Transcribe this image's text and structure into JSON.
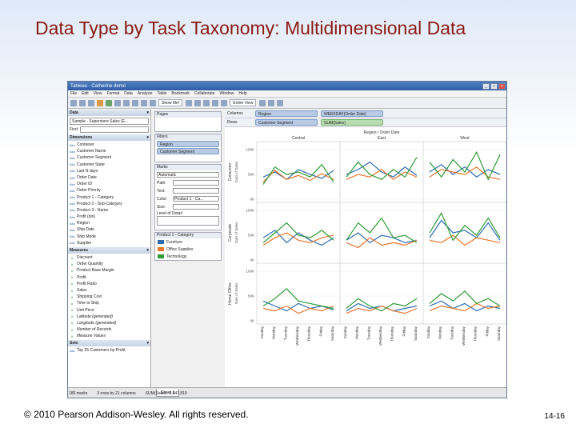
{
  "slide": {
    "title": "Data Type by Task Taxonomy: Multidimensional Data",
    "copyright": "© 2010 Pearson Addison-Wesley. All rights reserved.",
    "page_number": "14-16"
  },
  "window": {
    "title": "Tableau - Catherine demo",
    "menu": [
      "File",
      "Edit",
      "View",
      "Format",
      "Data",
      "Analysis",
      "Table",
      "Bookmark",
      "Collaborate",
      "Window",
      "Help"
    ],
    "toolbar": {
      "show_me": "Show Me!",
      "view_mode": "Entire View"
    }
  },
  "data_pane": {
    "header": "Data",
    "datasource": "Sample - Superstore Sales (E...",
    "find_label": "Find:",
    "dimensions_header": "Dimensions",
    "dimensions": [
      "Container",
      "Customer Name",
      "Customer Segment",
      "Customer State",
      "Last N days",
      "Order Date",
      "Order ID",
      "Order Priority",
      "Product 1 - Category",
      "Product 2 - Sub-Category",
      "Product 3 - Name",
      "Profit (bin)",
      "Region",
      "Ship Date",
      "Ship Mode",
      "Supplier"
    ],
    "measures_header": "Measures",
    "measures": [
      "Discount",
      "Order Quantity",
      "Product Base Margin",
      "Profit",
      "Profit Ratio",
      "Sales",
      "Shipping Cost",
      "Time to Ship",
      "Unit Price",
      "Latitude (generated)",
      "Longitude (generated)",
      "Number of Records",
      "Measure Values"
    ],
    "sets_header": "Sets",
    "sets": [
      "Top 25 Customers by Profit"
    ]
  },
  "shelves": {
    "pages": "Pages",
    "filters": "Filters",
    "filter_items": [
      "Region",
      "Customer Segment"
    ],
    "marks": "Marks",
    "mark_type": "Automatic",
    "path": "Path:",
    "text": "Text:",
    "color": "Color:",
    "color_field": "Product 1 - Ca...",
    "size": "Size:",
    "level_of_detail": "Level of Detail",
    "legend_title": "Product 1 - Category",
    "legend": [
      {
        "name": "Furniture",
        "color": "#2b6cb0"
      },
      {
        "name": "Office Supplies",
        "color": "#e8772e"
      },
      {
        "name": "Technology",
        "color": "#2e9b36"
      }
    ],
    "columns_label": "Columns",
    "columns": [
      "Region",
      "WEEKDAY(Order Date)"
    ],
    "rows_label": "Rows",
    "rows": [
      "Customer Segment",
      "SUM(Sales)"
    ]
  },
  "status": {
    "sheet_tab": "Sheet 1",
    "marks": "189 marks",
    "dims": "3 rows by 21 columns",
    "sum": "SUM(Sales): 8,947,819"
  },
  "chart_data": {
    "type": "line",
    "header_title": "Region / Order Date",
    "regions": [
      "Central",
      "East",
      "West"
    ],
    "segments": [
      "Consumer",
      "Corporate",
      "Home Office"
    ],
    "ylabel": "Sum of Sales",
    "yticks": [
      "0K",
      "50K",
      "100K"
    ],
    "ylim": [
      0,
      110000
    ],
    "categories": [
      "Sunday",
      "Monday",
      "Tuesday",
      "Wednesday",
      "Thursday",
      "Friday",
      "Saturday"
    ],
    "series_names": [
      "Furniture",
      "Office Supplies",
      "Technology"
    ],
    "colors": [
      "#2b6cb0",
      "#e8772e",
      "#2e9b36"
    ],
    "values": [
      [
        [
          [
            45000,
            55000,
            40000,
            60000,
            50000,
            42000,
            58000
          ],
          [
            35000,
            58000,
            40000,
            48000,
            38000,
            52000,
            40000
          ],
          [
            30000,
            65000,
            50000,
            55000,
            45000,
            70000,
            35000
          ]
        ],
        [
          [
            50000,
            60000,
            75000,
            55000,
            45000,
            65000,
            48000
          ],
          [
            40000,
            50000,
            45000,
            60000,
            40000,
            55000,
            45000
          ],
          [
            45000,
            75000,
            50000,
            40000,
            60000,
            45000,
            85000
          ]
        ],
        [
          [
            55000,
            70000,
            50000,
            65000,
            45000,
            60000,
            50000
          ],
          [
            45000,
            60000,
            55000,
            50000,
            65000,
            45000,
            40000
          ],
          [
            75000,
            45000,
            80000,
            55000,
            95000,
            40000,
            90000
          ]
        ]
      ],
      [
        [
          [
            45000,
            60000,
            35000,
            55000,
            40000,
            30000,
            45000
          ],
          [
            30000,
            45000,
            55000,
            40000,
            35000,
            45000,
            50000
          ],
          [
            35000,
            55000,
            75000,
            50000,
            45000,
            60000,
            40000
          ]
        ],
        [
          [
            40000,
            55000,
            35000,
            50000,
            45000,
            35000,
            40000
          ],
          [
            35000,
            25000,
            45000,
            30000,
            35000,
            30000,
            40000
          ],
          [
            40000,
            75000,
            55000,
            85000,
            45000,
            50000,
            35000
          ]
        ],
        [
          [
            45000,
            80000,
            55000,
            60000,
            45000,
            75000,
            40000
          ],
          [
            40000,
            35000,
            50000,
            30000,
            45000,
            40000,
            35000
          ],
          [
            55000,
            95000,
            40000,
            70000,
            50000,
            85000,
            45000
          ]
        ]
      ],
      [
        [
          [
            40000,
            30000,
            20000,
            35000,
            25000,
            30000,
            22000
          ],
          [
            25000,
            20000,
            30000,
            15000,
            25000,
            20000,
            30000
          ],
          [
            30000,
            45000,
            65000,
            40000,
            35000,
            30000,
            25000
          ]
        ],
        [
          [
            20000,
            35000,
            25000,
            30000,
            20000,
            25000,
            30000
          ],
          [
            15000,
            25000,
            20000,
            30000,
            20000,
            15000,
            25000
          ],
          [
            25000,
            45000,
            30000,
            20000,
            35000,
            30000,
            45000
          ]
        ],
        [
          [
            30000,
            40000,
            25000,
            35000,
            20000,
            30000,
            25000
          ],
          [
            20000,
            30000,
            25000,
            20000,
            35000,
            25000,
            30000
          ],
          [
            35000,
            55000,
            40000,
            60000,
            35000,
            45000,
            30000
          ]
        ]
      ]
    ]
  }
}
